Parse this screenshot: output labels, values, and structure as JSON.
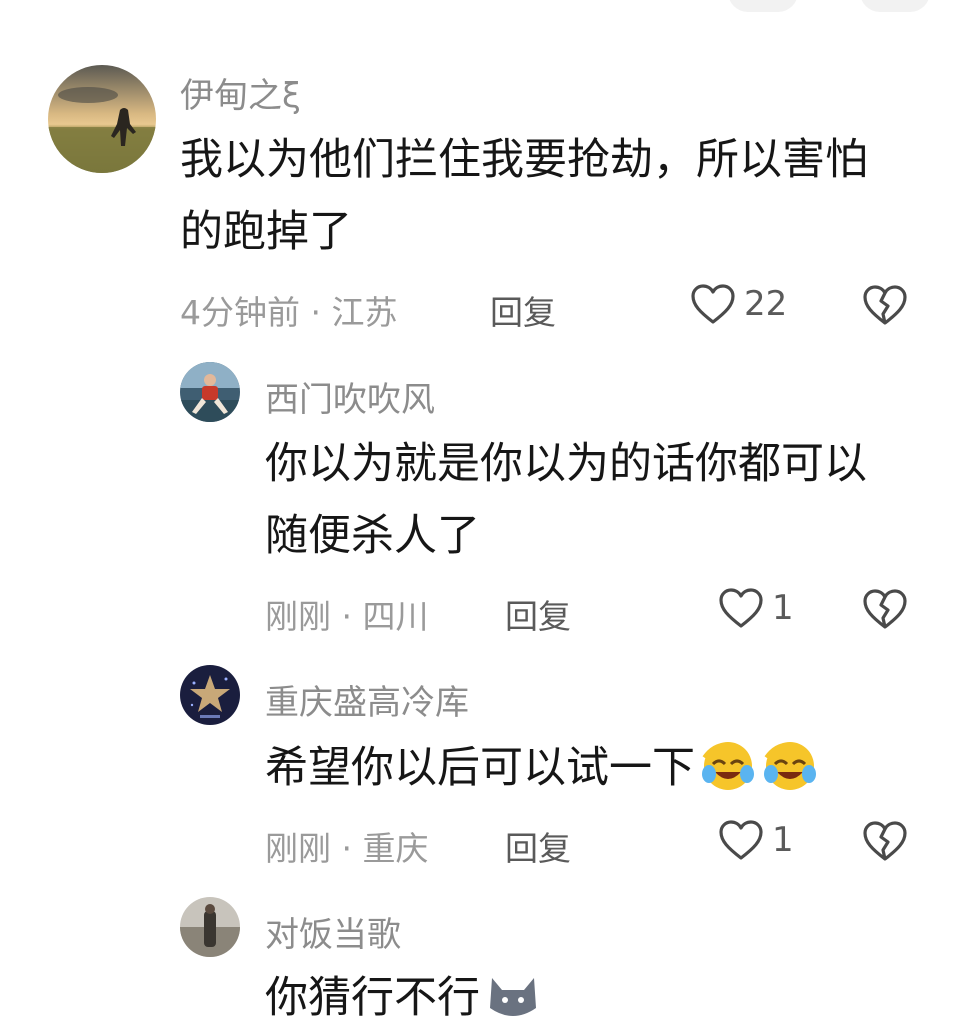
{
  "comments": [
    {
      "user": "伊甸之ξ",
      "text": "我以为他们拦住我要抢劫，所以害怕的跑掉了",
      "line1": "我以为他们拦住我要抢劫，所以害怕",
      "line2": "的跑掉了",
      "meta": "4分钟前 · 江苏",
      "reply": "回复",
      "likes": "22"
    },
    {
      "user": "西门吹吹风",
      "line1": "你以为就是你以为的话你都可以",
      "line2": "随便杀人了",
      "meta": "刚刚 · 四川",
      "reply": "回复",
      "likes": "1"
    },
    {
      "user": "重庆盛高冷库",
      "line1": "希望你以后可以试一下",
      "emoji": "laughing-crying-emoji",
      "meta": "刚刚 · 重庆",
      "reply": "回复",
      "likes": "1"
    },
    {
      "user": "对饭当歌",
      "line1": "你猜行不行"
    }
  ],
  "icons": {
    "like": "heart-outline-icon",
    "dislike": "broken-heart-icon"
  },
  "colors": {
    "text": "#161616",
    "username": "#8c8c8c",
    "meta": "#9a9a9a",
    "action": "#5a5a5a"
  }
}
